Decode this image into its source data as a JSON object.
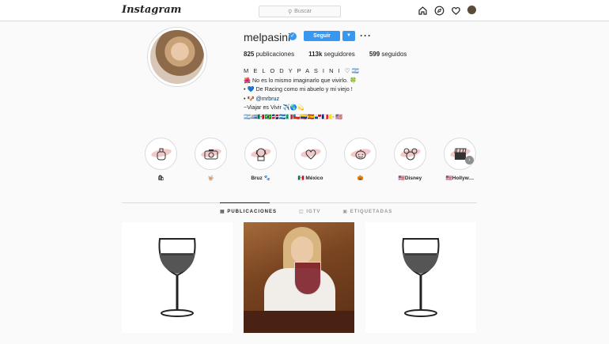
{
  "header": {
    "logo": "Instagram",
    "search_placeholder": "Buscar"
  },
  "profile": {
    "username": "melpasini",
    "follow_label": "Seguir",
    "stats": [
      {
        "count": "825",
        "label": "publicaciones"
      },
      {
        "count": "113k",
        "label": "seguidores"
      },
      {
        "count": "599",
        "label": "seguidos"
      }
    ],
    "bio": {
      "name": "M E L O D Y  P A S I N I ♡🇦🇷",
      "line1": "🌺 No es lo mismo imaginarlo que vivirlo. 🍀",
      "line2": "• 💙 De Racing como mi abuelo y mi viejo !",
      "line3_prefix": "• 🐶 ",
      "line3_link": "@mrbruz",
      "line4": "~Viajar es Vivir ✈️🌎💫",
      "line5": "🇦🇷🇺🇾🇲🇽🇧🇷🇩🇴🇳🇮🇮🇹🇨🇱🇨🇴🇪🇸🇵🇦🇫🇷🇻🇦🇺🇸"
    }
  },
  "highlights": [
    {
      "label": "🛍",
      "icon": "perfume-icon"
    },
    {
      "label": "🤟🏼",
      "icon": "camera-icon"
    },
    {
      "label": "Bruz 🐾",
      "icon": "dog-icon"
    },
    {
      "label": "🇲🇽 México",
      "icon": "heart-icon"
    },
    {
      "label": "🎃",
      "icon": "pumpkin-icon"
    },
    {
      "label": "🇺🇸Disney",
      "icon": "mickey-icon"
    },
    {
      "label": "🇺🇸Hollyw…",
      "icon": "clapperboard-icon"
    }
  ],
  "tabs": [
    {
      "label": "PUBLICACIONES",
      "active": true,
      "icon": "grid-icon"
    },
    {
      "label": "IGTV",
      "active": false,
      "icon": "igtv-icon"
    },
    {
      "label": "ETIQUETADAS",
      "active": false,
      "icon": "tag-icon"
    }
  ],
  "posts": [
    {
      "kind": "illustration",
      "icon": "wine-glass-icon"
    },
    {
      "kind": "photo"
    },
    {
      "kind": "illustration",
      "icon": "wine-glass-icon"
    }
  ],
  "colors": {
    "accent": "#3897f0",
    "border": "#dbdbdb",
    "background": "#fafafa"
  }
}
